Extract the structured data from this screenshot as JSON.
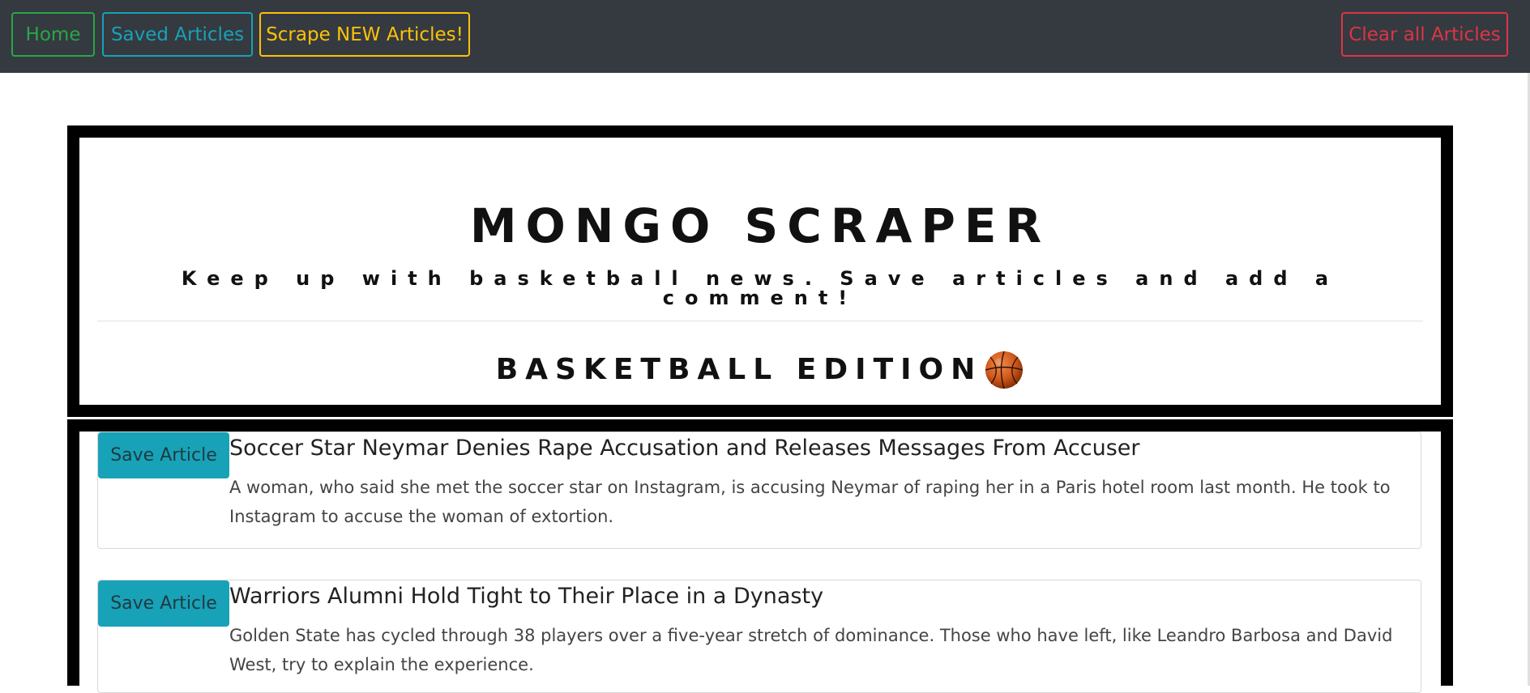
{
  "nav": {
    "home_label": "Home",
    "saved_label": "Saved Articles",
    "scrape_label": "Scrape NEW Articles!",
    "clear_label": "Clear all Articles"
  },
  "header": {
    "title": "MONGO SCRAPER",
    "subtitle": "Keep up with basketball news. Save articles and add a comment!",
    "edition": "BASKETBALL EDITION"
  },
  "articles": [
    {
      "button_label": "Save Article",
      "headline": "Soccer Star Neymar Denies Rape Accusation and Releases Messages From Accuser",
      "summary": "A woman, who said she met the soccer star on Instagram, is accusing Neymar of raping her in a Paris hotel room last month. He took to Instagram to accuse the woman of extortion."
    },
    {
      "button_label": "Save Article",
      "headline": "Warriors Alumni Hold Tight to Their Place in a Dynasty",
      "summary": "Golden State has cycled through 38 players over a five-year stretch of dominance. Those who have left, like Leandro Barbosa and David West, try to explain the experience."
    }
  ],
  "colors": {
    "navbar": "#343a40",
    "home": "#28a745",
    "saved": "#17a2b8",
    "scrape": "#ffc107",
    "clear": "#dc3545",
    "save_button": "#17a2b8"
  },
  "icons": {
    "edition_icon": "basketball-icon"
  }
}
